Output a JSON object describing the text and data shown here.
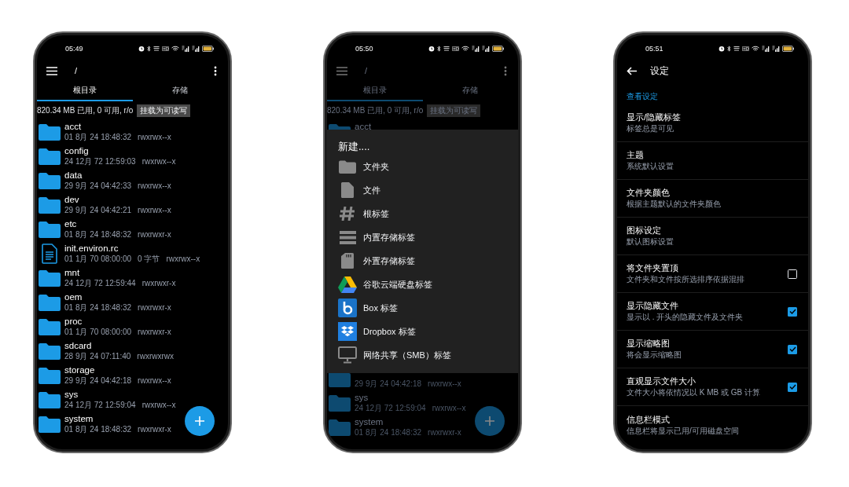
{
  "phones": [
    {
      "kind": "file_browser",
      "dimmed": false,
      "status_bar": {
        "time": "05:49"
      },
      "toolbar": {
        "path": "/"
      },
      "tabs": [
        {
          "label": "根目录",
          "selected": true
        },
        {
          "label": "存储",
          "selected": false
        }
      ],
      "info": {
        "text": "820.34 MB 已用, 0 可用, r/o",
        "button": "挂载为可读写"
      },
      "rows": [
        {
          "kind": "folder",
          "name": "acct",
          "date": "01 8月 24 18:48:32",
          "permissions": "rwxrwx--x"
        },
        {
          "kind": "folder",
          "name": "config",
          "date": "24 12月 72 12:59:03",
          "permissions": "rwxrwx--x"
        },
        {
          "kind": "folder",
          "name": "data",
          "date": "29 9月 24 04:42:33",
          "permissions": "rwxrwx--x"
        },
        {
          "kind": "folder",
          "name": "dev",
          "date": "29 9月 24 04:42:21",
          "permissions": "rwxrwx--x"
        },
        {
          "kind": "folder",
          "name": "etc",
          "date": "01 8月 24 18:48:32",
          "permissions": "rwxrwxr-x"
        },
        {
          "kind": "file",
          "name": "init.environ.rc",
          "date": "01 1月 70 08:00:00",
          "size": "0 字节",
          "permissions": "rwxrwx--x"
        },
        {
          "kind": "folder",
          "name": "mnt",
          "date": "24 12月 72 12:59:44",
          "permissions": "rwxrwxr-x"
        },
        {
          "kind": "folder",
          "name": "oem",
          "date": "01 8月 24 18:48:32",
          "permissions": "rwxrwxr-x"
        },
        {
          "kind": "folder",
          "name": "proc",
          "date": "01 1月 70 08:00:00",
          "permissions": "rwxrwxr-x"
        },
        {
          "kind": "folder",
          "name": "sdcard",
          "date": "28 9月 24 07:11:40",
          "permissions": "rwxrwxrwx"
        },
        {
          "kind": "folder",
          "name": "storage",
          "date": "29 9月 24 04:42:18",
          "permissions": "rwxrwx--x"
        },
        {
          "kind": "folder",
          "name": "sys",
          "date": "24 12月 72 12:59:04",
          "permissions": "rwxrwx--x"
        },
        {
          "kind": "folder",
          "name": "system",
          "date": "01 8月 24 18:48:32",
          "permissions": "rwxrwxr-x"
        }
      ]
    },
    {
      "kind": "file_browser",
      "dimmed": true,
      "status_bar": {
        "time": "05:50"
      },
      "toolbar": {
        "path": "/"
      },
      "tabs": [
        {
          "label": "根目录",
          "selected": true
        },
        {
          "label": "存储",
          "selected": false
        }
      ],
      "info": {
        "text": "820.34 MB 已用, 0 可用, r/o",
        "button": "挂载为可读写"
      },
      "rows": [
        {
          "kind": "folder",
          "name": "acct"
        },
        {
          "kind": "folder",
          "date": "29 9月 24 04:42:18",
          "permissions": "rwxrwx--x"
        },
        {
          "kind": "folder",
          "name": "sys",
          "date": "24 12月 72 12:59:04",
          "permissions": "rwxrwx--x"
        },
        {
          "kind": "folder",
          "name": "system",
          "date": "01 8月 24 18:48:32",
          "permissions": "rwxrwxr-x"
        }
      ],
      "dialog": {
        "title": "新建....",
        "items": [
          {
            "kind": "folder",
            "label": "文件夹"
          },
          {
            "kind": "file",
            "label": "文件"
          },
          {
            "kind": "root",
            "label": "根标签"
          },
          {
            "kind": "internal",
            "label": "内置存储标签"
          },
          {
            "kind": "external",
            "label": "外置存储标签"
          },
          {
            "kind": "gdrive",
            "label": "谷歌云端硬盘标签"
          },
          {
            "kind": "box",
            "label": "Box 标签"
          },
          {
            "kind": "dropbox",
            "label": "Dropbox 标签"
          },
          {
            "kind": "smb",
            "label": "网络共享（SMB）标签"
          }
        ]
      }
    },
    {
      "kind": "settings",
      "status_bar": {
        "time": "05:51"
      },
      "toolbar": {
        "title": "设定"
      },
      "section": "查看设定",
      "items": [
        {
          "kind": "text",
          "title": "显示/隐藏标签",
          "subtitle": "标签总是可见"
        },
        {
          "kind": "text",
          "title": "主题",
          "subtitle": "系统默认设置"
        },
        {
          "kind": "text",
          "title": "文件夹颜色",
          "subtitle": "根据主题默认的文件夹颜色"
        },
        {
          "kind": "text",
          "title": "图标设定",
          "subtitle": "默认图标设置"
        },
        {
          "kind": "checkbox",
          "title": "将文件夹置顶",
          "subtitle": "文件夹和文件按所选排序依据混排",
          "checked": false
        },
        {
          "kind": "checkbox",
          "title": "显示隐藏文件",
          "subtitle": "显示以 . 开头的隐藏文件及文件夹",
          "checked": true
        },
        {
          "kind": "checkbox",
          "title": "显示缩略图",
          "subtitle": "将会显示缩略图",
          "checked": true
        },
        {
          "kind": "checkbox",
          "title": "直观显示文件大小",
          "subtitle": "文件大小将依情况以 K MB 或 GB 计算",
          "checked": true
        },
        {
          "kind": "text",
          "title": "信息栏模式",
          "subtitle": "信息栏将显示已用/可用磁盘空间"
        }
      ]
    }
  ]
}
